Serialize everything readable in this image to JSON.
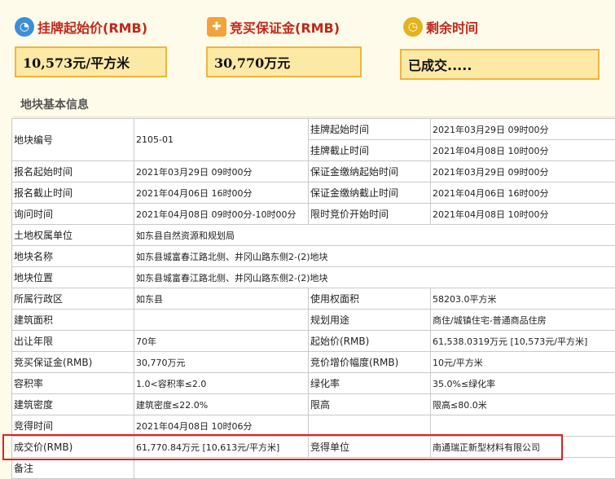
{
  "header": {
    "price_label": "挂牌起始价(RMB)",
    "deposit_label": "竞买保证金(RMB)",
    "time_label": "剩余时间",
    "price_value": "10,573元/平方米",
    "deposit_value": "30,770万元",
    "time_value": "已成交....."
  },
  "section_title": "地块基本信息",
  "table": {
    "r1": [
      "地块编号",
      "2105-01",
      "挂牌起始时间",
      "2021年03月29日 09时00分"
    ],
    "r2": [
      "挂牌截止时间",
      "2021年04月08日 10时00分"
    ],
    "r3": [
      "报名起始时间",
      "2021年03月29日 09时00分",
      "保证金缴纳起始时间",
      "2021年03月29日 09时00分"
    ],
    "r4": [
      "报名截止时间",
      "2021年04月06日 16时00分",
      "保证金缴纳截止时间",
      "2021年04月06日 16时00分"
    ],
    "r5": [
      "询问时间",
      "2021年04月08日 09时00分-10时00分",
      "限时竞价开始时间",
      "2021年04月08日 10时00分"
    ],
    "r6": [
      "土地权属单位",
      "如东县自然资源和规划局"
    ],
    "r7": [
      "地块名称",
      "如东县城富春江路北侧、井冈山路东侧2-(2)地块"
    ],
    "r8": [
      "地块位置",
      "如东县城富春江路北侧、井冈山路东侧2-(2)地块"
    ],
    "r9": [
      "所属行政区",
      "如东县",
      "使用权面积",
      "58203.0平方米"
    ],
    "r10": [
      "建筑面积",
      "",
      "规划用途",
      "商住/城镇住宅-普通商品住房"
    ],
    "r11": [
      "出让年限",
      "70年",
      "起始价(RMB)",
      "61,538.0319万元 [10,573元/平方米]"
    ],
    "r12": [
      "竞买保证金(RMB)",
      "30,770万元",
      "竞价增价幅度(RMB)",
      "10元/平方米"
    ],
    "r13": [
      "容积率",
      "1.0<容积率≤2.0",
      "绿化率",
      "35.0%≤绿化率"
    ],
    "r14": [
      "建筑密度",
      "建筑密度≤22.0%",
      "限高",
      "限高≤80.0米"
    ],
    "r15": [
      "竞得时间",
      "2021年04月08日 10时06分",
      "",
      ""
    ],
    "r16": [
      "成交价(RMB)",
      "61,770.84万元 [10,613元/平方米]",
      "竞得单位",
      "南通瑞正新型材料有限公司"
    ],
    "r17": [
      "备注",
      ""
    ]
  },
  "colors": {
    "accent": "#c0281c",
    "box_border": "#f0b43a",
    "box_fill": "#fce9a6",
    "highlight": "#e02020"
  }
}
